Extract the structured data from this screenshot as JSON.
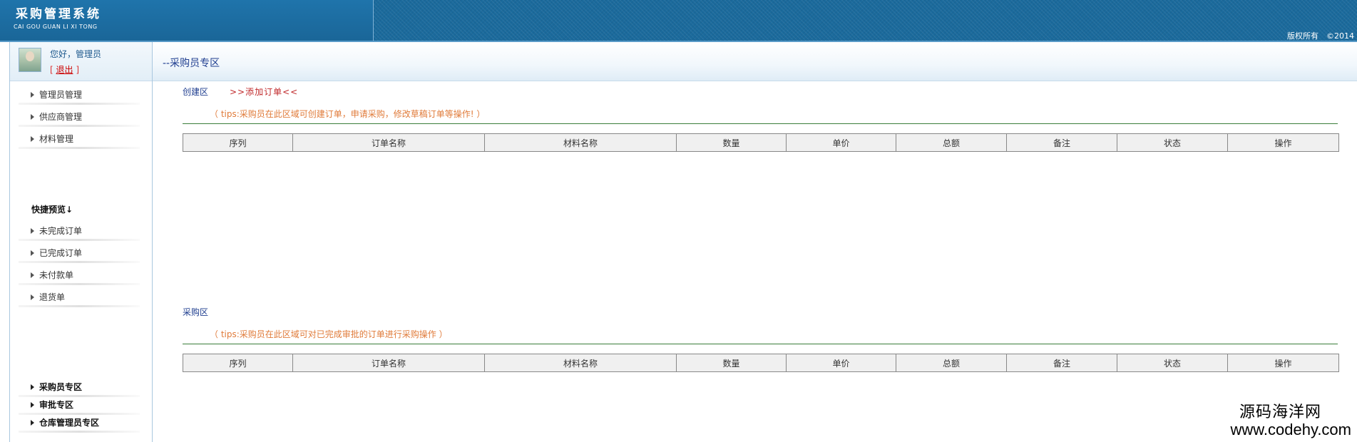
{
  "header": {
    "title": "采购管理系统",
    "subtitle": "CAI GOU GUAN LI XI TONG",
    "copyright": "版权所有　©2014"
  },
  "sidebar": {
    "greeting": "您好，管理员",
    "logout_prefix": "[ ",
    "logout": "退出",
    "logout_suffix": " ]",
    "nav_items": [
      {
        "label": "管理员管理"
      },
      {
        "label": "供应商管理"
      },
      {
        "label": "材料管理"
      }
    ],
    "quick_title": "快捷预览↓",
    "quick_items": [
      {
        "label": "未完成订单"
      },
      {
        "label": "已完成订单"
      },
      {
        "label": "未付款单"
      },
      {
        "label": "退货单"
      }
    ],
    "zone_items": [
      {
        "label": "采购员专区"
      },
      {
        "label": "审批专区"
      },
      {
        "label": "仓库管理员专区"
      }
    ]
  },
  "main": {
    "zone_title": "--采购员专区",
    "create": {
      "label": "创建区",
      "add_link": ">>添加订单<<",
      "tips": "（ tips:采购员在此区域可创建订单，申请采购，修改草稿订单等操作! ）"
    },
    "purchase": {
      "label": "采购区",
      "tips": "（ tips:采购员在此区域可对已完成审批的订单进行采购操作 ）"
    },
    "columns": [
      "序列",
      "订单名称",
      "材料名称",
      "数量",
      "单价",
      "总额",
      "备注",
      "状态",
      "操作"
    ]
  },
  "watermark": {
    "name": "源码海洋网",
    "url": "www.codehy.com"
  }
}
